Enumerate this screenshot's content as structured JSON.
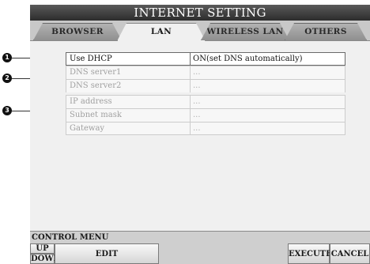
{
  "title": "INTERNET SETTING",
  "tabs": [
    {
      "label": "BROWSER"
    },
    {
      "label": "LAN"
    },
    {
      "label": "WIRELESS LAN"
    },
    {
      "label": "OTHERS"
    }
  ],
  "active_tab": "LAN",
  "settings": [
    {
      "label": "Use DHCP",
      "value": "ON(set DNS automatically)"
    },
    {
      "label": "DNS server1",
      "value": "..."
    },
    {
      "label": "DNS server2",
      "value": "..."
    },
    {
      "label": "IP address",
      "value": "..."
    },
    {
      "label": "Subnet mask",
      "value": "..."
    },
    {
      "label": "Gateway",
      "value": "..."
    }
  ],
  "callouts": [
    "1",
    "2",
    "3"
  ],
  "control_menu": {
    "label": "CONTROL MENU",
    "up": "UP",
    "down": "DOWN",
    "edit": "EDIT",
    "execute": "EXECUTE",
    "cancel": "CANCEL"
  }
}
